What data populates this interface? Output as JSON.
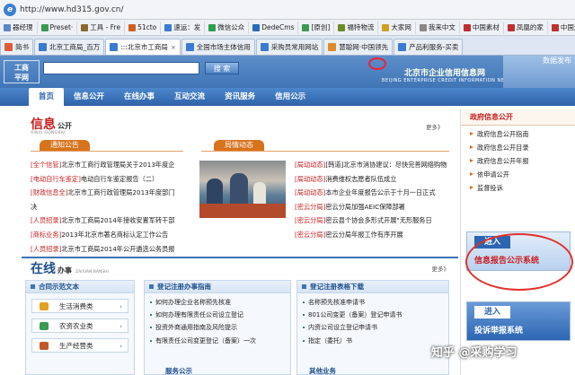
{
  "browser": {
    "address": "http://www.hd315.gov.cn/",
    "favorites": [
      {
        "label": "器经理",
        "color": "#5a88c8"
      },
      {
        "label": "Preset·",
        "color": "#3a9a52"
      },
      {
        "label": "工具 - Fre",
        "color": "#8a6a2e"
      },
      {
        "label": "51cto",
        "color": "#d06020"
      },
      {
        "label": "速运：发",
        "color": "#3a7ad0"
      },
      {
        "label": "微信公众",
        "color": "#2aa04a"
      },
      {
        "label": "DedeCms",
        "color": "#2a6ab8"
      },
      {
        "label": "[原创]",
        "color": "#3a9a52"
      },
      {
        "label": "福特物流",
        "color": "#6a8a2a"
      },
      {
        "label": "大家网",
        "color": "#d0a020"
      },
      {
        "label": "我来中文",
        "color": "#888888"
      },
      {
        "label": "中国素材",
        "color": "#c03030"
      },
      {
        "label": "凤凰的家",
        "color": "#c03030"
      },
      {
        "label": "中国沥",
        "color": "#c03030"
      }
    ],
    "tabs": [
      {
        "label": "简书",
        "color": "#e05a3a",
        "active": false
      },
      {
        "label": "北京工商局_百万",
        "color": "#3a7ad0",
        "active": false
      },
      {
        "label": ":::北京市工商局",
        "color": "#3a7ad0",
        "active": true
      },
      {
        "label": "全国市场主体信用",
        "color": "#3a7ad0",
        "active": false
      },
      {
        "label": "采购员常用网站",
        "color": "#3a7ad0",
        "active": false
      },
      {
        "label": "慧聪网·中国领先",
        "color": "#e08a2a",
        "active": false
      },
      {
        "label": "产品利服务-买卖",
        "color": "#3a7ad0",
        "active": false
      }
    ],
    "close_glyph": "×"
  },
  "header": {
    "logo_line1": "工商",
    "logo_line2": "平网",
    "search_placeholder": "",
    "search_button": "搜 索",
    "brand_cn": "北京市企业信用信息网",
    "brand_en": "BEIJING ENTERPRISE CREDIT INFORMATION NET",
    "corner": "数据发布"
  },
  "nav": [
    "首页",
    "信息公开",
    "在线办事",
    "互动交流",
    "资讯服务",
    "信用公示"
  ],
  "info": {
    "title": "信息",
    "title_small": "公开",
    "title_en": "XINXI GONGKAI",
    "more": "更多》",
    "sub_left": "通知公告",
    "sub_right": "局情动态",
    "left_items": [
      {
        "tag": "[全个信管]",
        "text": "北京市工商行政管理局关于2013年度企"
      },
      {
        "tag": "[电动自行车鉴定]",
        "text": "电动自行车鉴定报告（二）"
      },
      {
        "tag": "[财政信息全]",
        "text": "北京市工商行政管理局2013年度部门"
      },
      {
        "tag": "",
        "text": "决"
      },
      {
        "tag": "[人员招录]",
        "text": "北京市工商局2014年接收安置军转干部"
      },
      {
        "tag": "[商标业务]",
        "text": "2013年北京市著名商标认定工作公告"
      },
      {
        "tag": "[人员招录]",
        "text": "北京市工商局2014年公开遴选公务员报"
      }
    ],
    "right_items": [
      {
        "tag": "[局动动态]",
        "text": "[韩道]北京市消协建议：尽快完善网络购物"
      },
      {
        "tag": "[局动动态]",
        "text": "消费维权志愿者队伍成立"
      },
      {
        "tag": "[局动动态]",
        "text": "本市企业年度报告公示于十月一日正式"
      },
      {
        "tag": "[密云分局]",
        "text": "密云分局加强AEIC保障部署"
      },
      {
        "tag": "[密云分局]",
        "text": "密云县个协会多形式开展\"无形服务日"
      },
      {
        "tag": "[密云分局]",
        "text": "密云分局年报工作有序开展"
      }
    ]
  },
  "online": {
    "title": "在线",
    "title_small": "办事",
    "title_en": "ZAIXIAN BANSHI",
    "more": "更多》",
    "box1_title": "合同示范文本",
    "categories": [
      "生活消费类",
      "农资农业类",
      "生产经营类"
    ],
    "box2_title": "登记注册办事指南",
    "box2_items": [
      "如何办理企业名称预先核准",
      "如何办理有限责任公司设立登记",
      "投资外商通用指南及风险提示",
      "有限责任公司变更登记（备案）一次"
    ],
    "box3_title": "登记注册表格下载",
    "box3_items": [
      "名称预先核准申请书",
      "801公司变更（备案）登记申请书",
      "内资公司设立登记申请书",
      "指定（委托）书"
    ],
    "footer_left": "服务公示",
    "footer_right": "其他业务",
    "arrow": "›"
  },
  "side": {
    "title": "政府信息公开",
    "items": [
      "政府信息公开指南",
      "政府信息公开目录",
      "政府信息公开年报",
      "依申请公开",
      "监督投诉"
    ],
    "banner1_in": "进入",
    "banner1_text": "信息报告公示系统",
    "banner2_in": "进入",
    "banner2_text": "投诉举报系统"
  },
  "watermark": {
    "text": "知乎 @采购学习"
  }
}
